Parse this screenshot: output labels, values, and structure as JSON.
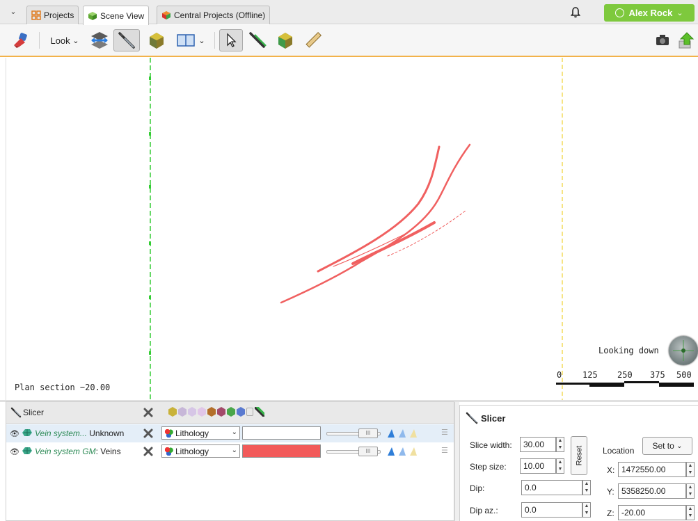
{
  "tabs": [
    {
      "label": "Projects",
      "icon": "projects-grid-icon",
      "active": false
    },
    {
      "label": "Scene View",
      "icon": "scene-cube-icon",
      "active": true
    },
    {
      "label": "Central Projects (Offline)",
      "icon": "central-cube-icon",
      "active": false
    }
  ],
  "user": {
    "name": "Alex Rock"
  },
  "toolbar": {
    "look_label": "Look"
  },
  "scene": {
    "plan_section": "Plan section −20.00",
    "looking": "Looking down",
    "scale_ticks": [
      "0",
      "125",
      "250",
      "375",
      "500"
    ],
    "vein_color": "#f06060"
  },
  "objects": {
    "header_label": "Slicer",
    "rows": [
      {
        "name_italic": "Vein system...",
        "name_rest": " Unknown",
        "colouring": "Lithology",
        "color": "#ffffff"
      },
      {
        "name_italic": "Vein system GM",
        "name_rest": ": Veins",
        "colouring": "Lithology",
        "color": "#f25a5a"
      }
    ]
  },
  "properties": {
    "title": "Slicer",
    "slice_width_label": "Slice width:",
    "slice_width": "30.00",
    "step_size_label": "Step size:",
    "step_size": "10.00",
    "dip_label": "Dip:",
    "dip": "0.0",
    "dip_az_label": "Dip az.:",
    "dip_az": "0.0",
    "reset_label": "Reset",
    "location_label": "Location",
    "set_to_label": "Set to",
    "x_label": "X:",
    "x": "1472550.00",
    "y_label": "Y:",
    "y": "5358250.00",
    "z_label": "Z:",
    "z": "-20.00"
  }
}
